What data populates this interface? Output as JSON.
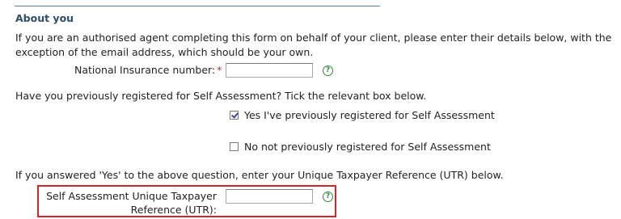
{
  "section": {
    "title": "About you"
  },
  "intro": {
    "line1": "If you are an authorised agent completing this form on behalf of your client, please enter their details below, with the",
    "line2": "exception of the email address, which should be your own."
  },
  "nino": {
    "label": "National Insurance number:",
    "required_marker": "*",
    "value": "",
    "help_symbol": "?"
  },
  "registration_question": {
    "text": "Have you previously registered for Self Assessment? Tick the relevant box below.",
    "options": [
      {
        "label": "Yes I've previously registered for Self Assessment",
        "checked": true
      },
      {
        "label": "No not previously registered for Self Assessment",
        "checked": false
      }
    ]
  },
  "utr": {
    "instruction": "If you answered 'Yes' to the above question, enter your Unique Taxpayer Reference (UTR) below.",
    "label_line1": "Self Assessment Unique Taxpayer",
    "label_line2": "Reference (UTR):",
    "value": "",
    "help_symbol": "?",
    "highlight_color": "#d5232c"
  },
  "colors": {
    "section_title": "#2e4d66",
    "required": "#c0282f",
    "help_icon": "#2f8a42"
  }
}
